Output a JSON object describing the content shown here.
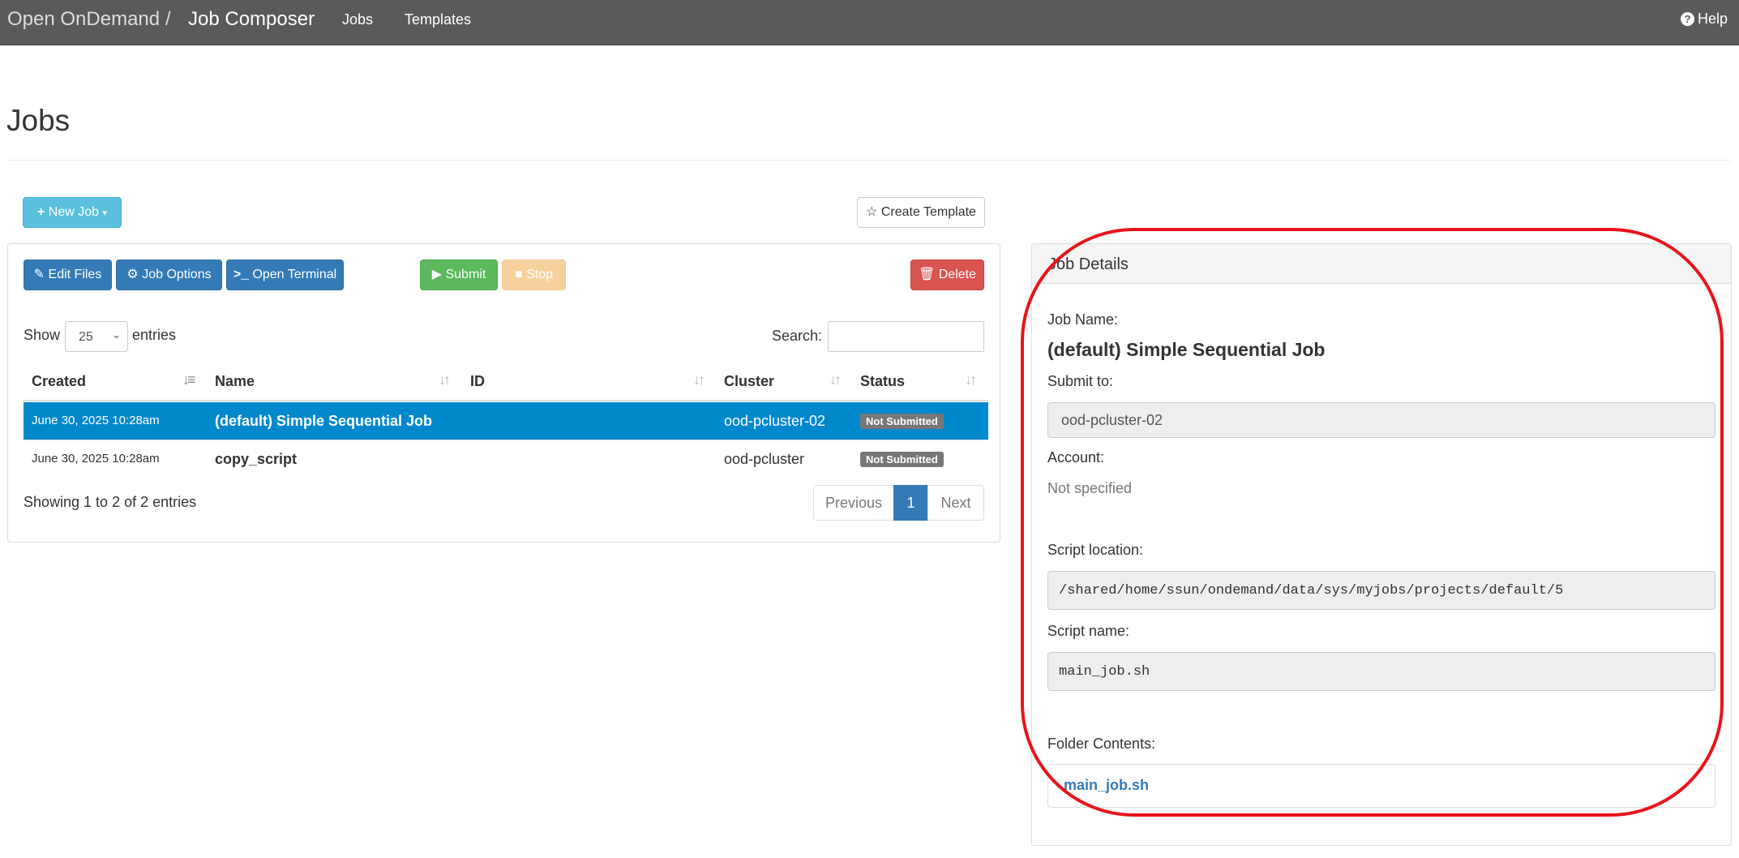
{
  "nav": {
    "brand": "Open OnDemand",
    "separator": "/",
    "app": "Job Composer",
    "links": [
      "Jobs",
      "Templates"
    ],
    "help": "Help"
  },
  "page_title": "Jobs",
  "toolbar": {
    "new_job": "New Job",
    "create_template": "Create Template",
    "edit_files": "Edit Files",
    "job_options": "Job Options",
    "open_terminal": "Open Terminal",
    "submit": "Submit",
    "stop": "Stop",
    "delete": "Delete"
  },
  "table": {
    "show_label": "Show",
    "page_size": "25",
    "entries_label": "entries",
    "search_label": "Search:",
    "columns": [
      "Created",
      "Name",
      "ID",
      "Cluster",
      "Status"
    ],
    "rows": [
      {
        "created": "June 30, 2025 10:28am",
        "name": "(default) Simple Sequential Job",
        "id": "",
        "cluster": "ood-pcluster-02",
        "status": "Not Submitted",
        "selected": true
      },
      {
        "created": "June 30, 2025 10:28am",
        "name": "copy_script",
        "id": "",
        "cluster": "ood-pcluster",
        "status": "Not Submitted",
        "selected": false
      }
    ],
    "info": "Showing 1 to 2 of 2 entries",
    "pagination": {
      "previous": "Previous",
      "current": "1",
      "next": "Next"
    }
  },
  "details": {
    "title": "Job Details",
    "job_name_label": "Job Name:",
    "job_name": "(default) Simple Sequential Job",
    "submit_to_label": "Submit to:",
    "submit_to": "ood-pcluster-02",
    "account_label": "Account:",
    "account": "Not specified",
    "script_location_label": "Script location:",
    "script_location": "/shared/home/ssun/ondemand/data/sys/myjobs/projects/default/5",
    "script_name_label": "Script name:",
    "script_name": "main_job.sh",
    "folder_contents_label": "Folder Contents:",
    "folder_files": [
      "main_job.sh"
    ]
  },
  "colors": {
    "navbar": "#5a5a5a",
    "selected_row": "#0088cc",
    "highlight_annotation": "#e8141a"
  }
}
